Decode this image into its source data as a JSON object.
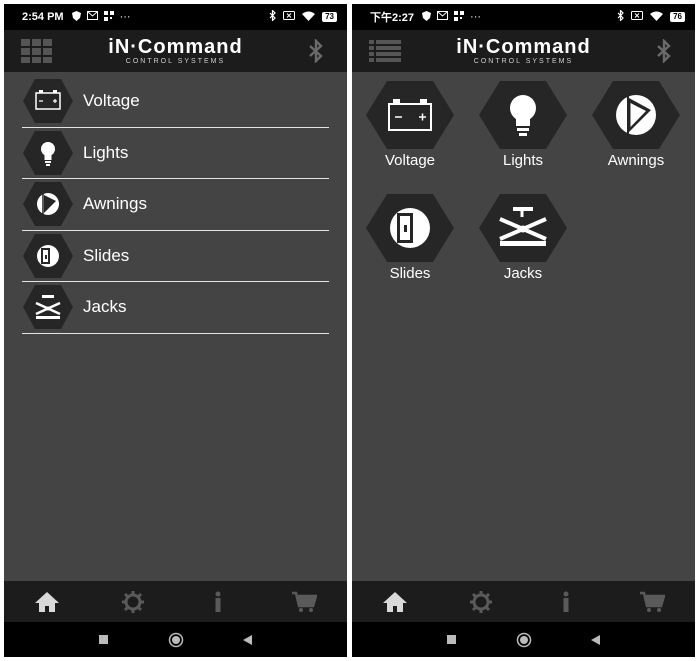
{
  "status_left": {
    "time": "2:54 PM",
    "battery": "73",
    "overflow": "···"
  },
  "status_right": {
    "time": "下午2:27",
    "battery": "76",
    "overflow": "···"
  },
  "brand": {
    "name": "iN·Command",
    "subtitle": "CONTROL SYSTEMS"
  },
  "menu_items": [
    {
      "label": "Voltage",
      "icon": "battery-icon"
    },
    {
      "label": "Lights",
      "icon": "lightbulb-icon"
    },
    {
      "label": "Awnings",
      "icon": "awning-icon"
    },
    {
      "label": "Slides",
      "icon": "slide-icon"
    },
    {
      "label": "Jacks",
      "icon": "jack-icon"
    }
  ],
  "bottom_nav": [
    "home-icon",
    "gear-icon",
    "info-icon",
    "cart-icon"
  ],
  "colors": {
    "background": "#444444",
    "header": "#1c1c1c",
    "hex": "#262626",
    "divider": "#e4e4e4",
    "nav_active": "#d9d9d9",
    "nav_inactive": "#5a5a5a"
  }
}
